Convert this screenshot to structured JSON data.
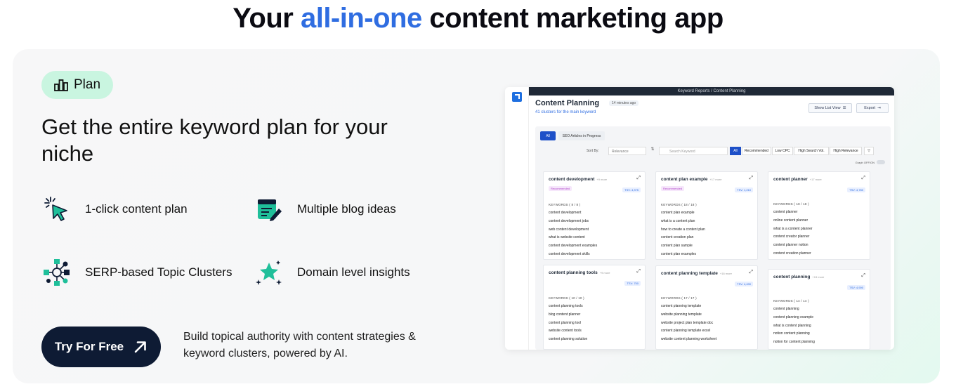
{
  "headline": {
    "prefix": "Your ",
    "accent": "all-in-one",
    "suffix": " content marketing app"
  },
  "pill": {
    "label": "Plan",
    "icon": "bar-chart-icon"
  },
  "subhead": "Get the entire keyword plan for your niche",
  "features": [
    {
      "label": "1-click content plan",
      "icon": "click-cursor-icon"
    },
    {
      "label": "Multiple blog ideas",
      "icon": "edit-list-icon"
    },
    {
      "label": "SERP-based Topic Clusters",
      "icon": "cluster-network-icon"
    },
    {
      "label": "Domain level insights",
      "icon": "sparkle-star-icon"
    }
  ],
  "cta": {
    "label": "Try For Free",
    "icon": "arrow-up-right-icon"
  },
  "cta_text": "Build topical authority with content strategies & keyword clusters, powered by AI.",
  "colors": {
    "accent": "#2f6de1",
    "cta_bg": "#0e1b34",
    "pill_bg": "#c9f5e0",
    "icon_teal": "#1fbf9a"
  },
  "app": {
    "breadcrumb": "Keyword Reports / Content Planning",
    "title": "Content Planning",
    "time": "14 minutes ago",
    "subtitle": "41 clusters for the main keyword",
    "show_list_view": "Show List View",
    "export": "Export",
    "tabs": [
      "All",
      "SEO Articles in Progress"
    ],
    "sort_by": "Sort By:",
    "sort_value": "Relevance",
    "search_placeholder": "Search Keyword",
    "filters": [
      "All",
      "Recommended",
      "Low CPC",
      "High Search Vol.",
      "High Relevance"
    ],
    "graph_toggle": "Graph OFF/ON",
    "clusters": [
      {
        "title": "content development",
        "more": "+9 more",
        "badge": "Recommended",
        "tsv": "TSV: 4,375",
        "kw": "KEYWORDS ( 8 / 8 )",
        "items": [
          "content development",
          "content development jobs",
          "web content development",
          "what is website content",
          "content development examples",
          "content development skills"
        ]
      },
      {
        "title": "content plan example",
        "more": "+17 more",
        "badge": "Recommended",
        "tsv": "TSV: 1,210",
        "kw": "KEYWORDS ( 18 / 18 )",
        "items": [
          "content plan example",
          "what is a content plan",
          "how to create a content plan",
          "content creation plan",
          "content plan sample",
          "content plan examples"
        ]
      },
      {
        "title": "content planner",
        "more": "+17 more",
        "badge": "",
        "tsv": "TSV: 4,780",
        "kw": "KEYWORDS ( 18 / 18 )",
        "items": [
          "content planner",
          "online content planner",
          "what is a content planner",
          "content creator planner",
          "content planner notion",
          "content creation planner"
        ]
      },
      {
        "title": "content planning tools",
        "more": "+9 more",
        "badge": "",
        "tsv": "TSV: 750",
        "kw": "KEYWORDS ( 10 / 10 )",
        "items": [
          "content planning tools",
          "blog content planner",
          "content planning tool",
          "website content tools",
          "content planning solution"
        ]
      },
      {
        "title": "content planning template",
        "more": "+16 more",
        "badge": "",
        "tsv": "TSV: 4,490",
        "kw": "KEYWORDS ( 17 / 17 )",
        "items": [
          "content planning template",
          "website planning template",
          "website project plan template doc",
          "content planning template excel",
          "website content planning worksheet"
        ]
      },
      {
        "title": "content planning",
        "more": "+13 more",
        "badge": "",
        "tsv": "TSV: 4,900",
        "kw": "KEYWORDS ( 14 / 14 )",
        "items": [
          "content planning",
          "content planning example",
          "what is content planning",
          "notion content planning",
          "notion for content planning"
        ]
      }
    ]
  }
}
